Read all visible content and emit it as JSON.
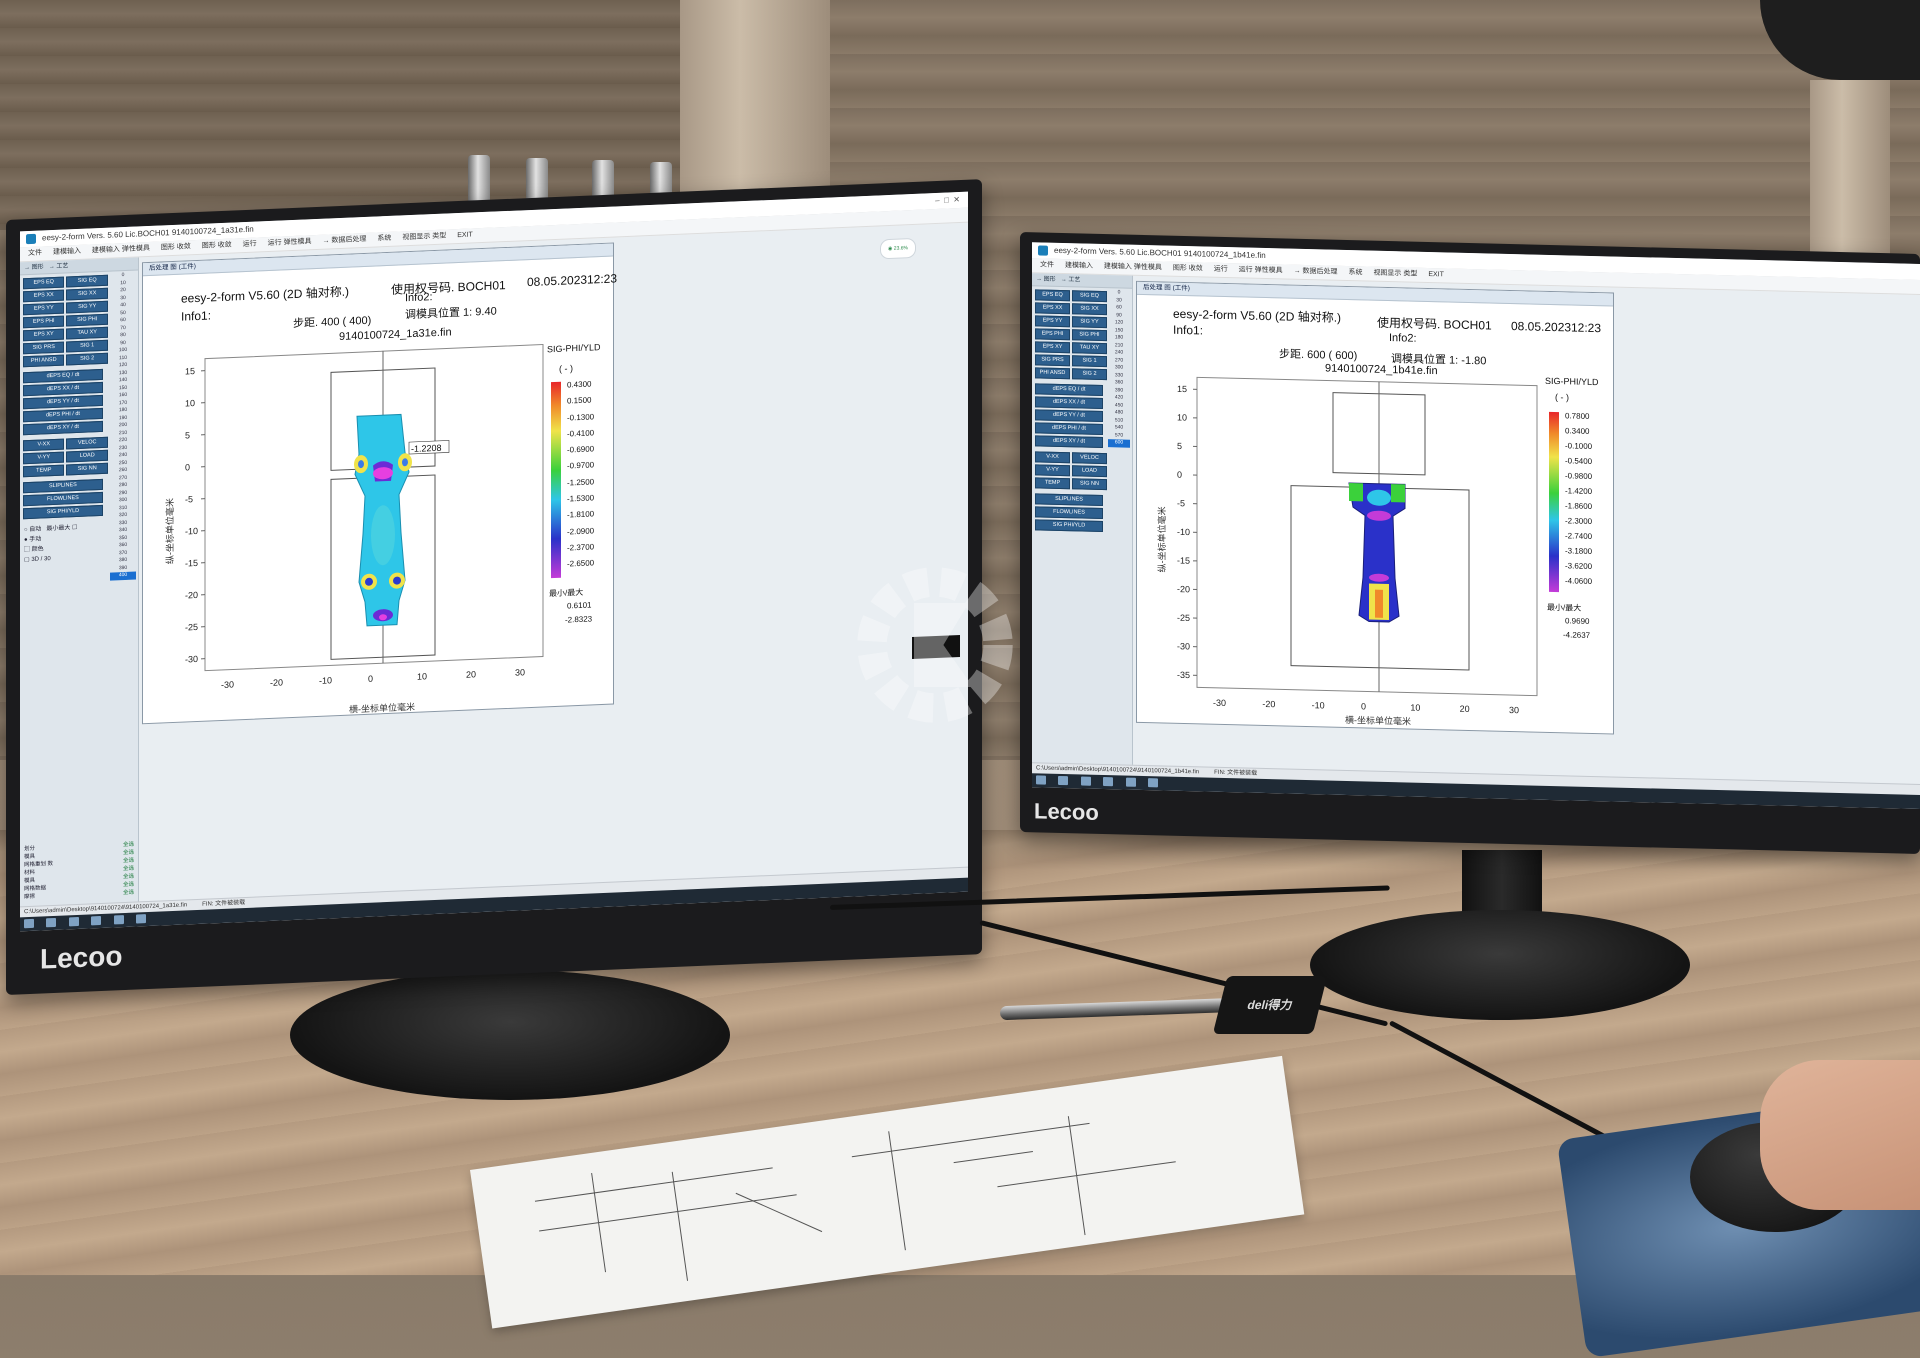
{
  "left": {
    "titlebar": "eesy-2-form  Vers. 5.60    Lic.BOCH01        9140100724_1a31e.fin",
    "menu": [
      "文件",
      "建模输入",
      "建模输入  弹性模具",
      "图形  收敛",
      "图形  收敛",
      "运行",
      "运行  弹性模具",
      "→ 数据后处理",
      "系统",
      "视图显示  类型",
      "EXIT"
    ],
    "panel_top": [
      "→ 图形",
      "→ 工艺"
    ],
    "btn_grid": [
      "EPS EQ",
      "SIG EQ",
      "EPS XX",
      "SIG XX",
      "EPS YY",
      "SIG YY",
      "EPS PHI",
      "SIG PHI",
      "EPS XY",
      "TAU XY",
      "SIG PRS",
      "SIG 1",
      "PHI ANSD",
      "SIG 2"
    ],
    "btn_wide": [
      "dEPS EQ / dt",
      "dEPS XX / dt",
      "dEPS YY / dt",
      "dEPS PHI / dt",
      "dEPS XY / dt"
    ],
    "btn_pairs": [
      [
        "V-XX",
        "VELOC"
      ],
      [
        "V-YY",
        "LOAD"
      ],
      [
        "TEMP",
        "SIG NN"
      ]
    ],
    "btn_more": [
      "SLIPLINES",
      "FLOWLINES",
      "SIG PHI/YLD"
    ],
    "step_list": [
      "0",
      "10",
      "20",
      "30",
      "40",
      "50",
      "60",
      "70",
      "80",
      "90",
      "100",
      "110",
      "120",
      "130",
      "140",
      "150",
      "160",
      "170",
      "180",
      "190",
      "200",
      "210",
      "220",
      "230",
      "240",
      "250",
      "260",
      "270",
      "280",
      "290",
      "300",
      "310",
      "320",
      "330",
      "340",
      "350",
      "360",
      "370",
      "380",
      "390",
      "400"
    ],
    "step_selected": "400",
    "opts": [
      "自动",
      "手动",
      "最小最大",
      "颜色",
      "3D / 30"
    ],
    "bottom_legend": [
      [
        "划分",
        "全选"
      ],
      [
        "模具",
        "全选"
      ],
      [
        "网格重划 数",
        "全选"
      ],
      [
        "材料",
        "全选"
      ],
      [
        "模具",
        "全选"
      ],
      [
        "网格数据",
        "全选"
      ],
      [
        "摩擦",
        "全选"
      ]
    ],
    "status": "C:\\Users\\admin\\Desktop\\9140100724\\9140100724_1a31e.fin",
    "status2": "FIN: 文件被装载",
    "rw_title": "后处理  图  (工件)",
    "header_title": "eesy-2-form V5.60 (2D 轴对称.)",
    "license": "使用权号码. BOCH01",
    "date": "08.05.2023",
    "time": "12:23",
    "info1": "Info1:",
    "info2": "Info2:",
    "step": "步距.  400 ( 400)",
    "die_pos": "调模具位置   1:    9.40",
    "file": "9140100724_1a31e.fin",
    "legend_title": "SIG-PHI/YLD",
    "legend_unit": "( - )",
    "legend_values": [
      "0.4300",
      "0.1500",
      "-0.1300",
      "-0.4100",
      "-0.6900",
      "-0.9700",
      "-1.2500",
      "-1.5300",
      "-1.8100",
      "-2.0900",
      "-2.3700",
      "-2.6500"
    ],
    "minmax_label": "最小/最大",
    "min_val": "0.6101",
    "max_val": "-2.8323",
    "probe_value": "-1.2208",
    "y_axis_label": "纵-坐标单位毫米",
    "x_axis_label": "横-坐标单位毫米",
    "x_ticks": [
      "-30",
      "-20",
      "-10",
      "0",
      "10",
      "20",
      "30"
    ],
    "y_ticks": [
      "15",
      "10",
      "5",
      "0",
      "-5",
      "-10",
      "-15",
      "-20",
      "-25",
      "-30"
    ]
  },
  "right": {
    "titlebar": "eesy-2-form  Vers. 5.60    Lic.BOCH01        9140100724_1b41e.fin",
    "menu": [
      "文件",
      "建模输入",
      "建模输入  弹性模具",
      "图形  收敛",
      "运行",
      "运行  弹性模具",
      "→ 数据后处理",
      "系统",
      "视图显示  类型",
      "EXIT"
    ],
    "panel_top": [
      "→ 图形",
      "→ 工艺"
    ],
    "btn_grid": [
      "EPS EQ",
      "SIG EQ",
      "EPS XX",
      "SIG XX",
      "EPS YY",
      "SIG YY",
      "EPS PHI",
      "SIG PHI",
      "EPS XY",
      "TAU XY",
      "SIG PRS",
      "SIG 1",
      "PHI ANSD",
      "SIG 2"
    ],
    "btn_wide": [
      "dEPS EQ / dt",
      "dEPS XX / dt",
      "dEPS YY / dt",
      "dEPS PHI / dt",
      "dEPS XY / dt"
    ],
    "btn_pairs": [
      [
        "V-XX",
        "VELOC"
      ],
      [
        "V-YY",
        "LOAD"
      ],
      [
        "TEMP",
        "SIG NN"
      ]
    ],
    "btn_more": [
      "SLIPLINES",
      "FLOWLINES",
      "SIG PHI/YLD"
    ],
    "step_list": [
      "0",
      "30",
      "60",
      "90",
      "120",
      "150",
      "180",
      "210",
      "240",
      "270",
      "300",
      "330",
      "360",
      "390",
      "420",
      "450",
      "480",
      "510",
      "540",
      "570",
      "600"
    ],
    "step_selected": "600",
    "status": "C:\\Users\\admin\\Desktop\\9140100724\\9140100724_1b41e.fin",
    "status2": "FIN: 文件被装载",
    "rw_title": "后处理  图  (工件)",
    "header_title": "eesy-2-form V5.60 (2D 轴对称.)",
    "license": "使用权号码. BOCH01",
    "date": "08.05.2023",
    "time": "12:23",
    "info1": "Info1:",
    "info2": "Info2:",
    "step": "步距.  600 ( 600)",
    "die_pos": "调模具位置   1:   -1.80",
    "file": "9140100724_1b41e.fin",
    "legend_title": "SIG-PHI/YLD",
    "legend_unit": "( - )",
    "legend_values": [
      "0.7800",
      "0.3400",
      "-0.1000",
      "-0.5400",
      "-0.9800",
      "-1.4200",
      "-1.8600",
      "-2.3000",
      "-2.7400",
      "-3.1800",
      "-3.6200",
      "-4.0600"
    ],
    "minmax_label": "最小/最大",
    "min_val": "0.9690",
    "max_val": "-4.2637",
    "y_axis_label": "纵-坐标单位毫米",
    "x_axis_label": "横-坐标单位毫米",
    "x_ticks": [
      "-30",
      "-20",
      "-10",
      "0",
      "10",
      "20",
      "30"
    ],
    "y_ticks": [
      "15",
      "10",
      "5",
      "0",
      "-5",
      "-10",
      "-15",
      "-20",
      "-25",
      "-30",
      "-35"
    ]
  },
  "monitor_brand": "Lecoo",
  "pen_holder_brand": "deli得力",
  "colors": {
    "legend_top": "#e8262a",
    "legend_mid": "#3bd13b",
    "legend_low": "#2a31c9",
    "legend_bottom": "#c43bd8",
    "part_cyan": "#2ec6e8"
  }
}
